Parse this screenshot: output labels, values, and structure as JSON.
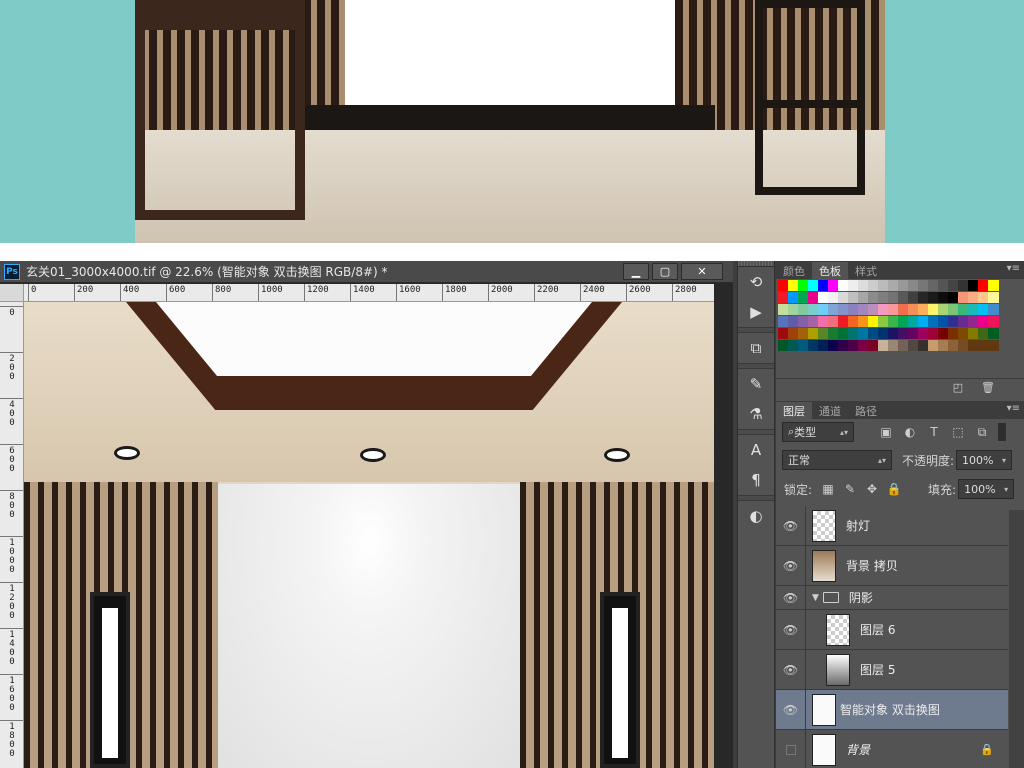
{
  "document": {
    "title": "玄关01_3000x4000.tif @ 22.6% (智能对象 双击换图  RGB/8#) *",
    "app_icon": "Ps",
    "window_buttons": [
      "minimize-icon",
      "restore-icon",
      "close-icon"
    ]
  },
  "rulers": {
    "top_labels": [
      "0",
      "200",
      "400",
      "600",
      "800",
      "1000",
      "1200",
      "1400",
      "1600",
      "1800",
      "2000",
      "2200",
      "2400",
      "2600",
      "2800"
    ],
    "left_labels": [
      "0",
      "200",
      "400",
      "600",
      "800",
      "1000",
      "1200",
      "1400",
      "1600",
      "1800"
    ]
  },
  "tools": [
    "history-icon",
    "play-action-icon",
    "properties-icon",
    "brush-presets-icon",
    "clone-source-icon",
    "character-icon",
    "paragraph-icon",
    "adjustments-icon"
  ],
  "swatch_panel": {
    "tabs": [
      "颜色",
      "色板",
      "样式"
    ],
    "active_tab": "色板",
    "colors": [
      [
        "#ff0000",
        "#ffff00",
        "#00ff00",
        "#00ffff",
        "#0000ff",
        "#ff00ff",
        "#ffffff",
        "#eeeeee",
        "#dddddd",
        "#cccccc",
        "#bbbbbb",
        "#aaaaaa",
        "#999999",
        "#888888",
        "#777777",
        "#666666",
        "#555555",
        "#444444",
        "#333333",
        "#000000",
        "#ff0000",
        "#ffff00"
      ],
      [
        "#ed1c24",
        "#0099ff",
        "#00a651",
        "#ec008c",
        "#ffffff",
        "#f2f2f2",
        "#d9d9d9",
        "#bfbfbf",
        "#a6a6a6",
        "#8c8c8c",
        "#7f7f7f",
        "#737373",
        "#595959",
        "#404040",
        "#262626",
        "#1a1a1a",
        "#0d0d0d",
        "#000000",
        "#f7977a",
        "#f9ad81",
        "#fdc68a",
        "#fff79a"
      ],
      [
        "#c4df9b",
        "#a3d39c",
        "#82ca9d",
        "#7bcdc8",
        "#6ecff6",
        "#7ea7d8",
        "#8493ca",
        "#8882be",
        "#a187be",
        "#bc8dbf",
        "#f49ac2",
        "#f6989d",
        "#f26c4f",
        "#f68e55",
        "#fbaf5d",
        "#fff467",
        "#acd372",
        "#7cc576",
        "#3bb878",
        "#1abbb4",
        "#00bff3",
        "#438ccb"
      ],
      [
        "#5574b9",
        "#605ca8",
        "#855fa8",
        "#a763a8",
        "#f06ea9",
        "#f26d7d",
        "#ed1c24",
        "#f26522",
        "#f7941d",
        "#fff200",
        "#8dc73f",
        "#39b54a",
        "#00a651",
        "#00a99d",
        "#00aeef",
        "#0072bc",
        "#0054a6",
        "#2e3192",
        "#662d91",
        "#92278f",
        "#ec008c",
        "#ed145b"
      ],
      [
        "#9e0b0f",
        "#a0410d",
        "#a3620a",
        "#aba000",
        "#598527",
        "#197b30",
        "#007236",
        "#00746b",
        "#0076a3",
        "#004b80",
        "#003471",
        "#1b1464",
        "#440e62",
        "#630460",
        "#9e005d",
        "#9e0039",
        "#790000",
        "#7b2e00",
        "#7d4900",
        "#827b00",
        "#406618",
        "#005e20"
      ],
      [
        "#005826",
        "#005952",
        "#005b7f",
        "#003663",
        "#002157",
        "#0d004c",
        "#32004b",
        "#4b0049",
        "#7b0046",
        "#7a0026",
        "#c7b299",
        "#998675",
        "#736357",
        "#534741",
        "#37302d",
        "#c69c6d",
        "#a67c52",
        "#8c6239",
        "#754c24",
        "#603913",
        "#603913",
        "#603913"
      ]
    ]
  },
  "layers_panel": {
    "tabs": [
      "图层",
      "通道",
      "路径"
    ],
    "active_tab": "图层",
    "filter_kind": "类型",
    "blend_mode": "正常",
    "opacity_label": "不透明度:",
    "opacity_value": "100%",
    "lock_label": "锁定:",
    "fill_label": "填充:",
    "fill_value": "100%",
    "layers": [
      {
        "name": "射灯",
        "visible": true,
        "kind": "checker"
      },
      {
        "name": "背景 拷贝",
        "visible": true,
        "kind": "photo"
      },
      {
        "name": "阴影",
        "visible": true,
        "kind": "group"
      },
      {
        "name": "图层 6",
        "visible": true,
        "kind": "checker"
      },
      {
        "name": "图层 5",
        "visible": true,
        "kind": "gradient"
      },
      {
        "name": "智能对象 双击换图",
        "visible": true,
        "kind": "smart",
        "selected": true
      },
      {
        "name": "背景",
        "visible": false,
        "kind": "white",
        "locked": true
      }
    ]
  }
}
